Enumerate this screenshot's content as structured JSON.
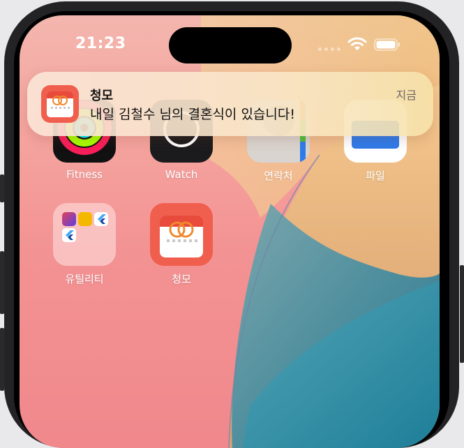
{
  "status_bar": {
    "time": "21:23",
    "icons": [
      "wifi-icon",
      "battery-icon"
    ]
  },
  "notification": {
    "app_name": "청모",
    "message": "내일 김철수 님의 결혼식이 있습니다!",
    "time": "지금",
    "icon": "wedding-rings-calendar-icon"
  },
  "apps": [
    {
      "label": "Fitness",
      "icon": "activity-rings-icon"
    },
    {
      "label": "Watch",
      "icon": "watch-icon"
    },
    {
      "label": "연락처",
      "icon": "contacts-icon"
    },
    {
      "label": "파일",
      "icon": "files-icon"
    },
    {
      "label": "유틸리티",
      "icon": "folder-icon"
    },
    {
      "label": "청모",
      "icon": "wedding-rings-calendar-icon"
    }
  ],
  "colors": {
    "notification_icon": "#f05e4d",
    "wallpaper": "#f39293",
    "accent_blue": "#2f7bea"
  }
}
